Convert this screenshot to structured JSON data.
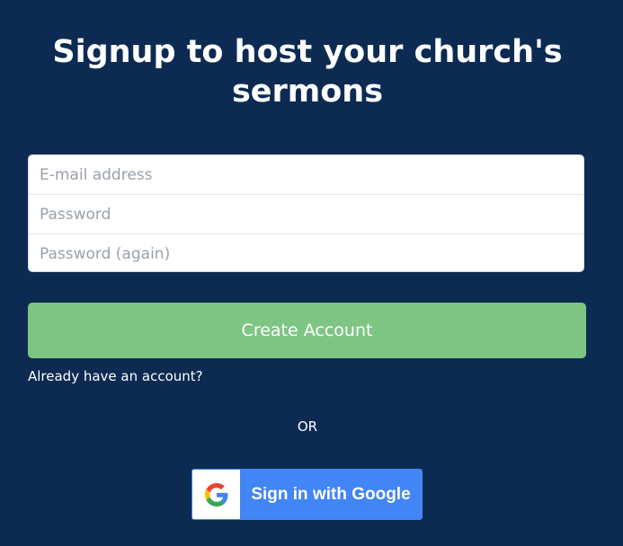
{
  "header": {
    "title": "Signup to host your church's sermons"
  },
  "form": {
    "email_placeholder": "E-mail address",
    "password_placeholder": "Password",
    "password_again_placeholder": "Password (again)",
    "submit_label": "Create Account"
  },
  "links": {
    "login": "Already have an account?"
  },
  "divider": {
    "or": "OR"
  },
  "google": {
    "label": "Sign in with Google",
    "icon": "google-g-icon"
  },
  "colors": {
    "background": "#0d2b52",
    "create_button": "#7ec584",
    "google_button": "#4285f4"
  }
}
